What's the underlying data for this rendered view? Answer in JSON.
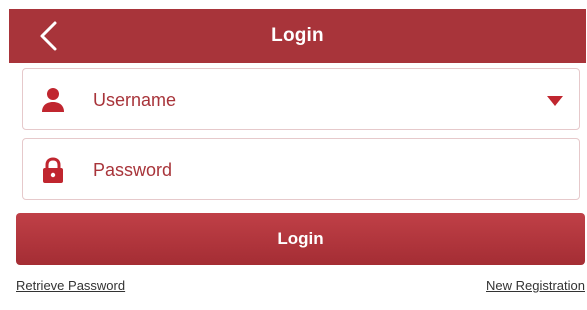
{
  "header": {
    "title": "Login",
    "back_icon": "chevron-left-icon"
  },
  "form": {
    "username": {
      "placeholder": "Username",
      "icon": "person-icon",
      "dropdown_icon": "triangle-down-icon"
    },
    "password": {
      "placeholder": "Password",
      "icon": "lock-icon"
    }
  },
  "actions": {
    "login_label": "Login",
    "retrieve_password": "Retrieve Password",
    "new_registration": "New Registration"
  },
  "colors": {
    "brand": "#a8343a",
    "accent": "#c0262f"
  }
}
